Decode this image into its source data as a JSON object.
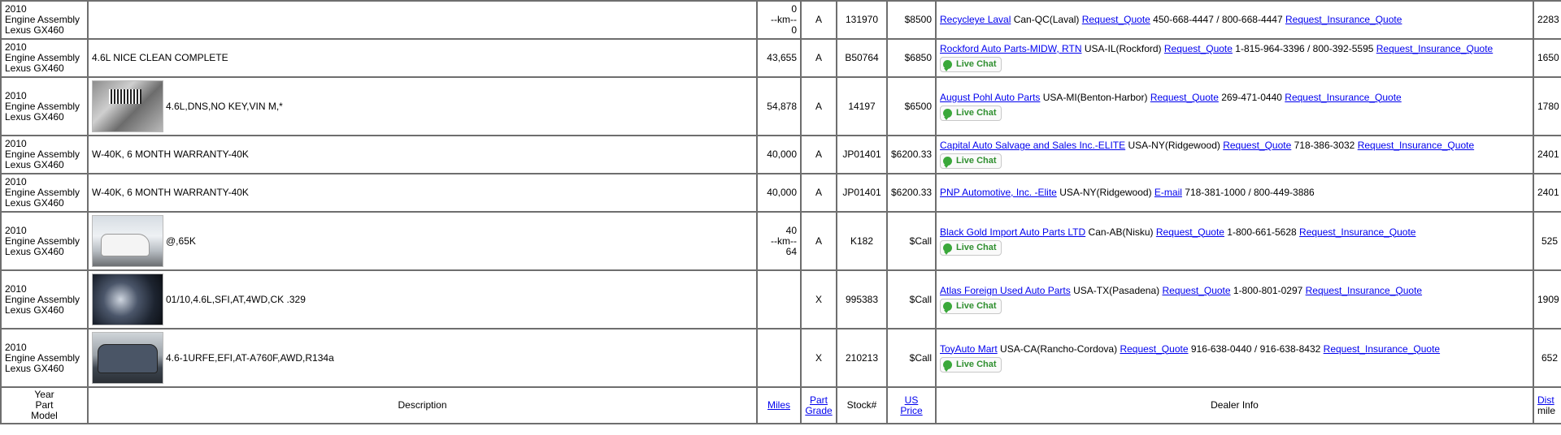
{
  "rows": [
    {
      "year": "2010",
      "part": "Engine Assembly",
      "model": "Lexus GX460",
      "thumb": "",
      "description": "",
      "miles_lines": [
        "0",
        "--km--",
        "0"
      ],
      "grade": "A",
      "stock": "131970",
      "price": "$8500",
      "dealer_name": "Recycleye Laval",
      "location": "Can-QC(Laval)",
      "contact_link": "Request_Quote",
      "phone": "450-668-4447 / 800-668-4447",
      "insurance_link": "Request_Insurance_Quote",
      "live_chat": false,
      "dist": "2283"
    },
    {
      "year": "2010",
      "part": "Engine Assembly",
      "model": "Lexus GX460",
      "thumb": "",
      "description": "4.6L NICE CLEAN COMPLETE",
      "miles_lines": [
        "43,655"
      ],
      "grade": "A",
      "stock": "B50764",
      "price": "$6850",
      "dealer_name": "Rockford Auto Parts-MIDW, RTN",
      "location": "USA-IL(Rockford)",
      "contact_link": "Request_Quote",
      "phone": "1-815-964-3396 / 800-392-5595",
      "insurance_link": "Request_Insurance_Quote",
      "live_chat": true,
      "dist": "1650"
    },
    {
      "year": "2010",
      "part": "Engine Assembly",
      "model": "Lexus GX460",
      "thumb": "engine1",
      "description": "4.6L,DNS,NO KEY,VIN M,*",
      "miles_lines": [
        "54,878"
      ],
      "grade": "A",
      "stock": "14197",
      "price": "$6500",
      "dealer_name": "August Pohl Auto Parts",
      "location": "USA-MI(Benton-Harbor)",
      "contact_link": "Request_Quote",
      "phone": "269-471-0440",
      "insurance_link": "Request_Insurance_Quote",
      "live_chat": true,
      "dist": "1780"
    },
    {
      "year": "2010",
      "part": "Engine Assembly",
      "model": "Lexus GX460",
      "thumb": "",
      "description": "W-40K, 6 MONTH WARRANTY-40K",
      "miles_lines": [
        "40,000"
      ],
      "grade": "A",
      "stock": "JP01401",
      "price": "$6200.33",
      "dealer_name": "Capital Auto Salvage and Sales Inc.-ELITE",
      "location": "USA-NY(Ridgewood)",
      "contact_link": "Request_Quote",
      "phone": "718-386-3032",
      "insurance_link": "Request_Insurance_Quote",
      "live_chat": true,
      "dist": "2401"
    },
    {
      "year": "2010",
      "part": "Engine Assembly",
      "model": "Lexus GX460",
      "thumb": "",
      "description": "W-40K, 6 MONTH WARRANTY-40K",
      "miles_lines": [
        "40,000"
      ],
      "grade": "A",
      "stock": "JP01401",
      "price": "$6200.33",
      "dealer_name": "PNP Automotive, Inc. -Elite",
      "location": "USA-NY(Ridgewood)",
      "contact_link": "E-mail",
      "phone": "718-381-1000 / 800-449-3886",
      "insurance_link": "",
      "live_chat": false,
      "dist": "2401"
    },
    {
      "year": "2010",
      "part": "Engine Assembly",
      "model": "Lexus GX460",
      "thumb": "suv-white",
      "description": "@,65K",
      "miles_lines": [
        "40",
        "--km--",
        "64"
      ],
      "grade": "A",
      "stock": "K182",
      "price": "$Call",
      "dealer_name": "Black Gold Import Auto Parts LTD",
      "location": "Can-AB(Nisku)",
      "contact_link": "Request_Quote",
      "phone": "1-800-661-5628",
      "insurance_link": "Request_Insurance_Quote",
      "live_chat": true,
      "dist": "525"
    },
    {
      "year": "2010",
      "part": "Engine Assembly",
      "model": "Lexus GX460",
      "thumb": "engine2",
      "description": "01/10,4.6L,SFI,AT,4WD,CK .329",
      "miles_lines": [],
      "grade": "X",
      "stock": "995383",
      "price": "$Call",
      "dealer_name": "Atlas Foreign Used Auto Parts",
      "location": "USA-TX(Pasadena)",
      "contact_link": "Request_Quote",
      "phone": "1-800-801-0297",
      "insurance_link": "Request_Insurance_Quote",
      "live_chat": true,
      "dist": "1909"
    },
    {
      "year": "2010",
      "part": "Engine Assembly",
      "model": "Lexus GX460",
      "thumb": "suv-blue",
      "description": "4.6-1URFE,EFI,AT-A760F,AWD,R134a",
      "miles_lines": [],
      "grade": "X",
      "stock": "210213",
      "price": "$Call",
      "dealer_name": "ToyAuto Mart",
      "location": "USA-CA(Rancho-Cordova)",
      "contact_link": "Request_Quote",
      "phone": "916-638-0440 / 916-638-8432",
      "insurance_link": "Request_Insurance_Quote",
      "live_chat": true,
      "dist": "652"
    }
  ],
  "live_chat_label": "Live Chat",
  "header": {
    "ypm_lines": [
      "Year",
      "Part",
      "Model"
    ],
    "description": "Description",
    "miles": "Miles",
    "grade_lines": [
      "Part",
      "Grade"
    ],
    "stock": "Stock#",
    "price_lines": [
      "US",
      "Price"
    ],
    "dealer": "Dealer Info",
    "dist_link": "Dist",
    "dist_unit": "mile"
  },
  "colors": {
    "link": "#0000ee",
    "border": "#6e6e6e",
    "live_chat_green": "#3aa83a"
  }
}
